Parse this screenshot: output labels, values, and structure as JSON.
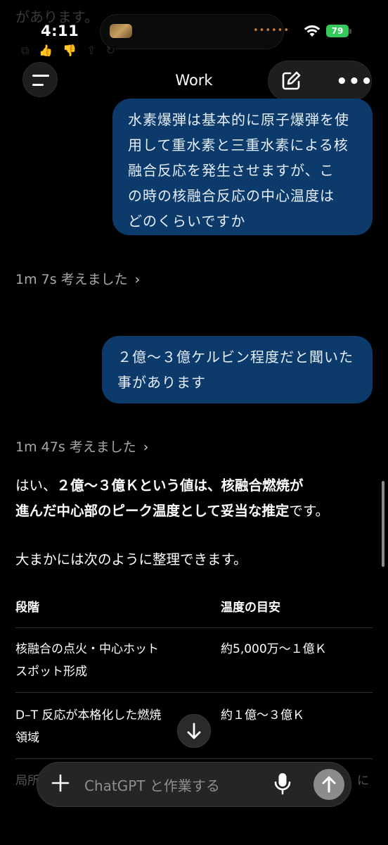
{
  "background_faded": {
    "top_text": "があります。"
  },
  "status_bar": {
    "time": "4:11",
    "battery": "79",
    "island_dots": "••••••"
  },
  "header": {
    "title": "Work",
    "menu_icon": "hamburger-menu-icon",
    "edit_icon": "new-chat-edit-icon",
    "more_icon": "more-dots-icon"
  },
  "messages": {
    "user_1": [
      "水素爆弾は基本的に原子爆弾を使",
      "用して重水素と三重水素による核",
      "融合反応を発生させますが、こ",
      "の時の核融合反応の中心温度は",
      "どのくらいですか"
    ],
    "thought_1": "1m 7s 考えました",
    "user_2": [
      "２億〜３億ケルビン程度だと聞いた",
      "事があります"
    ],
    "thought_2": "1m 47s 考えました",
    "answer": {
      "part1": "はい、",
      "bold1": "２億〜３億Ｋという値は、核融合燃焼が",
      "bold2": "進んだ中心部のピーク温度として妥当な推定",
      "part2": "です。"
    },
    "summary": "大まかには次のように整理できます。"
  },
  "table": {
    "headers": [
      "段階",
      "温度の目安"
    ],
    "rows": [
      {
        "stage": [
          "核融合の点火・中心ホット",
          "スポット形成"
        ],
        "temp": "約5,000万〜１億Ｋ"
      },
      {
        "stage": [
          "D–T 反応が本格化した燃焼",
          "領域"
        ],
        "temp": "約１億〜３億Ｋ"
      }
    ],
    "faded_row_left": "局所",
    "faded_row_right": "に"
  },
  "composer": {
    "placeholder": "ChatGPT と作業する",
    "plus_icon": "plus-icon",
    "mic_icon": "microphone-icon",
    "send_icon": "send-arrow-up-icon"
  },
  "scroll_down_icon": "arrow-down-icon",
  "colors": {
    "background": "#000000",
    "user_bubble": "#0b3a6b",
    "battery": "#34c759",
    "muted_text": "#a8a8a8"
  }
}
